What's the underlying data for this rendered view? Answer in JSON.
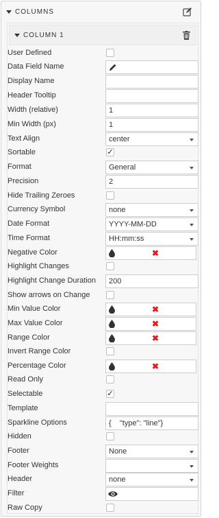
{
  "panel": {
    "title": "COLUMNS"
  },
  "column": {
    "title": "COLUMN 1"
  },
  "rows": {
    "user_defined": {
      "label": "User Defined",
      "checked": ""
    },
    "data_field_name": {
      "label": "Data Field Name",
      "icon": "pencil-icon"
    },
    "display_name": {
      "label": "Display Name",
      "value": ""
    },
    "header_tooltip": {
      "label": "Header Tooltip",
      "value": ""
    },
    "width_relative": {
      "label": "Width (relative)",
      "value": "1"
    },
    "min_width": {
      "label": "Min Width (px)",
      "value": "1"
    },
    "text_align": {
      "label": "Text Align",
      "value": "center"
    },
    "sortable": {
      "label": "Sortable",
      "checked": "✓"
    },
    "format": {
      "label": "Format",
      "value": "General"
    },
    "precision": {
      "label": "Precision",
      "value": "2"
    },
    "hide_trailing_zeroes": {
      "label": "Hide Trailing Zeroes",
      "checked": ""
    },
    "currency_symbol": {
      "label": "Currency Symbol",
      "value": "none"
    },
    "date_format": {
      "label": "Date Format",
      "value": "YYYY-MM-DD"
    },
    "time_format": {
      "label": "Time Format",
      "value": "HH:mm:ss"
    },
    "negative_color": {
      "label": "Negative Color"
    },
    "highlight_changes": {
      "label": "Highlight Changes",
      "checked": ""
    },
    "highlight_change_duration": {
      "label": "Highlight Change Duration",
      "value": "200"
    },
    "show_arrows_on_change": {
      "label": "Show arrows on Change",
      "checked": ""
    },
    "min_value_color": {
      "label": "Min Value Color"
    },
    "max_value_color": {
      "label": "Max Value Color"
    },
    "range_color": {
      "label": "Range Color"
    },
    "invert_range_color": {
      "label": "Invert Range Color",
      "checked": ""
    },
    "percentage_color": {
      "label": "Percentage Color"
    },
    "read_only": {
      "label": "Read Only",
      "checked": ""
    },
    "selectable": {
      "label": "Selectable",
      "checked": "✓"
    },
    "template": {
      "label": "Template",
      "value": ""
    },
    "sparkline_options": {
      "label": "Sparkline Options",
      "value": "{    \"type\": \"line\"}"
    },
    "hidden": {
      "label": "Hidden",
      "checked": ""
    },
    "footer": {
      "label": "Footer",
      "value": "None"
    },
    "footer_weights": {
      "label": "Footer Weights",
      "value": ""
    },
    "header": {
      "label": "Header",
      "value": "none"
    },
    "filter": {
      "label": "Filter",
      "icon": "eye-icon"
    },
    "raw_copy": {
      "label": "Raw Copy",
      "checked": ""
    }
  },
  "colors": {
    "clear_x": "#e31b1b",
    "border": "#cccccc",
    "panel_bg": "#f7f7f7"
  },
  "icons": {
    "clear": "✖"
  }
}
